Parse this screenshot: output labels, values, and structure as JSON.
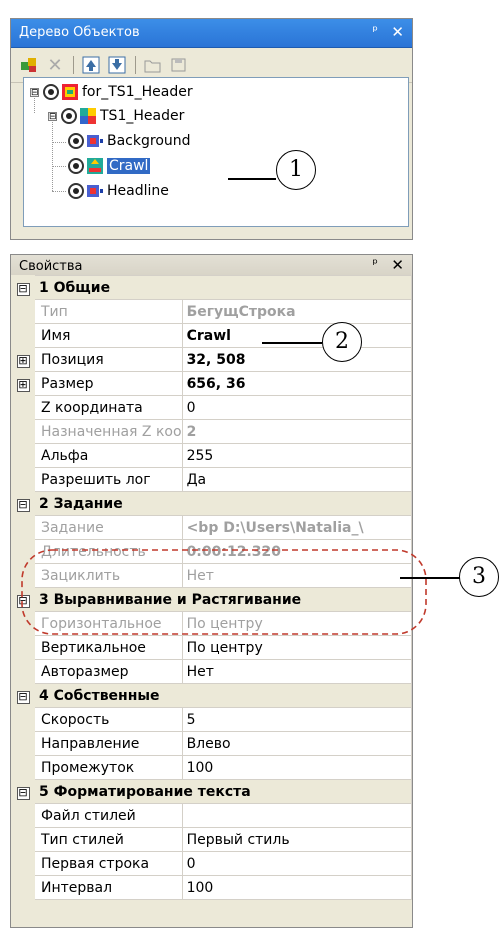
{
  "tree_panel": {
    "title": "Дерево Объектов",
    "pin_glyph": "ᵖ",
    "close_glyph": "✕",
    "nodes": [
      {
        "label": "for_TS1_Header",
        "expander": "⊟"
      },
      {
        "label": "TS1_Header",
        "expander": "⊟"
      },
      {
        "label": "Background"
      },
      {
        "label": "Crawl"
      },
      {
        "label": "Headline"
      }
    ]
  },
  "props_panel": {
    "title": "Свойства",
    "pin_glyph": "ᵖ",
    "close_glyph": "✕",
    "categories": [
      {
        "label": "1 Общие",
        "expander": "⊟"
      },
      {
        "label": "2 Задание",
        "expander": "⊟"
      },
      {
        "label": "3 Выравнивание и Растягивание",
        "expander": "⊟"
      },
      {
        "label": "4 Собственные",
        "expander": "⊟"
      },
      {
        "label": "5 Форматирование текста",
        "expander": "⊟"
      }
    ],
    "rows": [
      {
        "name": "Тип",
        "value": "БегущСтрока",
        "expander": ""
      },
      {
        "name": "Имя",
        "value": "Crawl",
        "expander": ""
      },
      {
        "name": "Позиция",
        "value": "32, 508",
        "expander": "⊞"
      },
      {
        "name": "Размер",
        "value": "656, 36",
        "expander": "⊞"
      },
      {
        "name": "Z координата",
        "value": "0",
        "expander": ""
      },
      {
        "name": "Назначенная Z коо",
        "value": "2",
        "expander": ""
      },
      {
        "name": "Альфа",
        "value": "255",
        "expander": ""
      },
      {
        "name": "Разрешить лог",
        "value": "Да",
        "expander": ""
      },
      {
        "name": "Задание",
        "value": "<bp D:\\Users\\Natalia_\\",
        "expander": ""
      },
      {
        "name": "Длительность",
        "value": "0:00:12.320",
        "expander": ""
      },
      {
        "name": "Зациклить",
        "value": "Нет",
        "expander": ""
      },
      {
        "name": "Горизонтальное",
        "value": "По центру",
        "expander": ""
      },
      {
        "name": "Вертикальное",
        "value": "По центру",
        "expander": ""
      },
      {
        "name": "Авторазмер",
        "value": "Нет",
        "expander": ""
      },
      {
        "name": "Скорость",
        "value": "5",
        "expander": ""
      },
      {
        "name": "Направление",
        "value": "Влево",
        "expander": ""
      },
      {
        "name": "Промежуток",
        "value": "100",
        "expander": ""
      },
      {
        "name": "Файл стилей",
        "value": "",
        "expander": ""
      },
      {
        "name": "Тип стилей",
        "value": "Первый стиль",
        "expander": ""
      },
      {
        "name": "Первая строка",
        "value": "0",
        "expander": ""
      },
      {
        "name": "Интервал",
        "value": "100",
        "expander": ""
      }
    ]
  },
  "callouts": [
    "1",
    "2",
    "3"
  ],
  "colors": {
    "title_blue": "#2a74d6",
    "selection": "#316ac5",
    "highlight_ring": "#c0392b",
    "disabled_text": "#a0a0a0"
  }
}
